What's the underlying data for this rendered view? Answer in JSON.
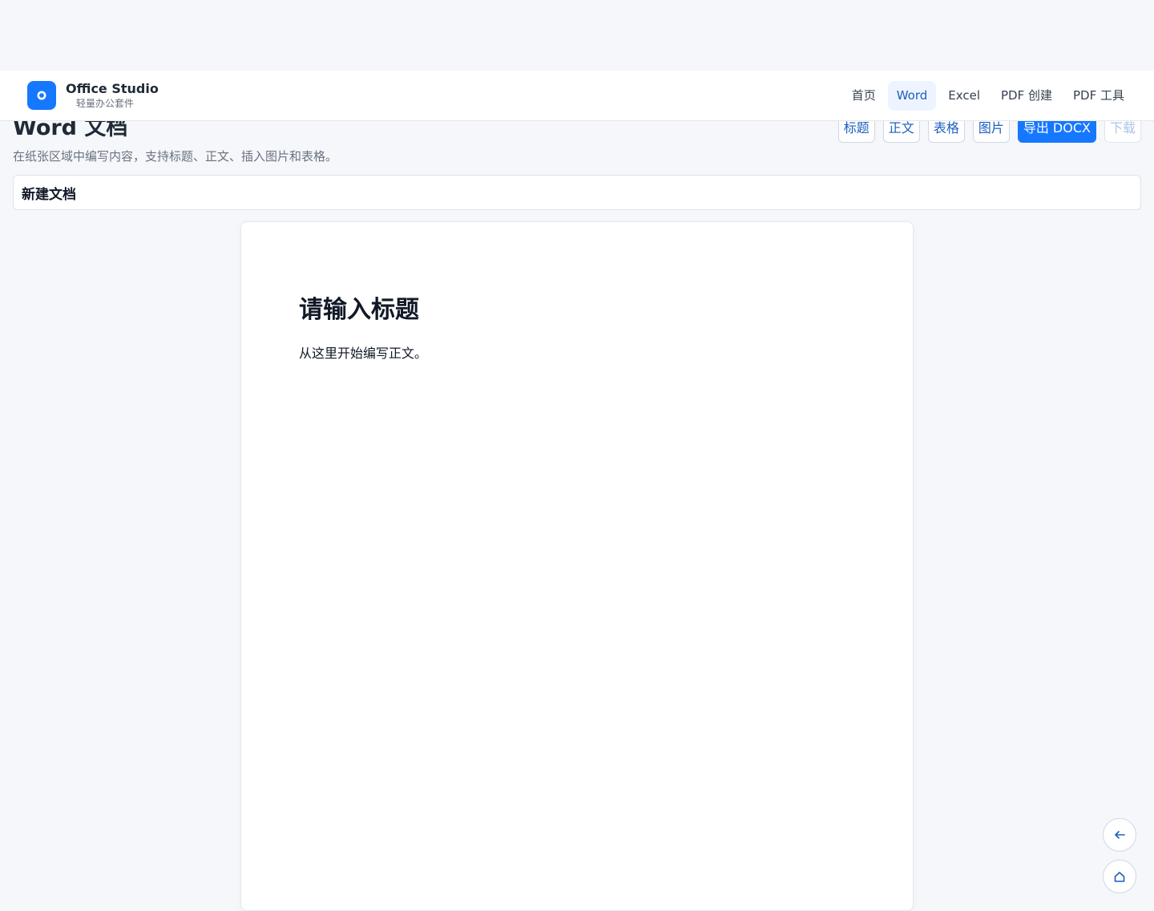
{
  "brand": {
    "name": "Office Studio",
    "tagline": "轻量办公套件",
    "logo_letter": "O"
  },
  "nav": {
    "items": [
      "首页",
      "Word",
      "Excel",
      "PDF 创建",
      "PDF 工具"
    ],
    "active": "Word"
  },
  "page": {
    "title": "Word 文档",
    "subtitle": "在纸张区域中编写内容，支持标题、正文、插入图片和表格。"
  },
  "toolbar": {
    "heading_label": "标题",
    "body_label": "正文",
    "table_label": "表格",
    "image_label": "图片",
    "export_label": "导出 DOCX",
    "download_label": "下载"
  },
  "document": {
    "name_value": "新建文档",
    "heading": "请输入标题",
    "body": "从这里开始编写正文。"
  },
  "fab": {
    "back_icon": "arrow-left-icon",
    "home_icon": "home-icon"
  },
  "colors": {
    "accent": "#1677ff",
    "background": "#f5f7fa"
  }
}
